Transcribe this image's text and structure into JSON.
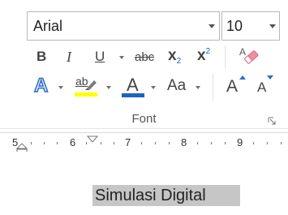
{
  "font_group": {
    "font_name": "Arial",
    "font_size": "10",
    "bold_label": "B",
    "italic_label": "I",
    "underline_label": "U",
    "strikethrough_label": "abc",
    "subscript_base": "x",
    "subscript_mark": "2",
    "superscript_base": "x",
    "superscript_mark": "2",
    "text_effects_label": "A",
    "highlight_label": "ab",
    "font_color_label": "A",
    "change_case_label": "Aa",
    "grow_font_label": "A",
    "shrink_font_label": "A",
    "group_label": "Font",
    "highlight_color": "#ffff00",
    "font_color": "#1e62c0"
  },
  "ruler": {
    "numbers": [
      "5",
      "6",
      "7",
      "8",
      "9"
    ]
  },
  "document": {
    "selected_text": "Simulasi Digital"
  }
}
